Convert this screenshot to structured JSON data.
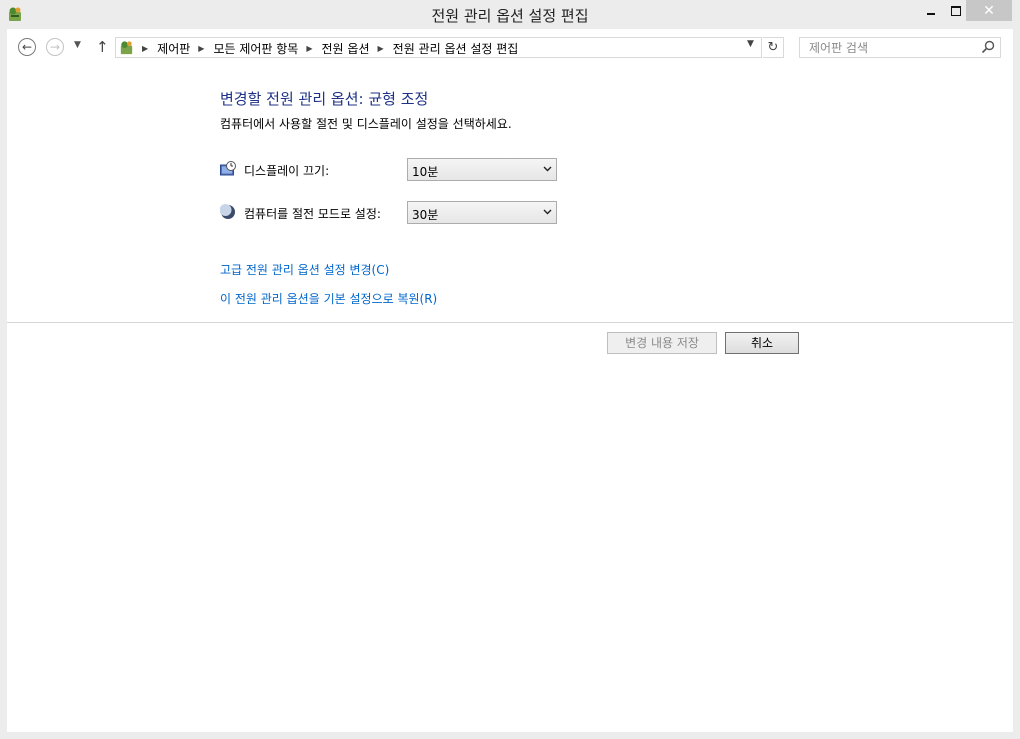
{
  "window": {
    "title": "전원 관리 옵션 설정 편집",
    "close_glyph": "✕"
  },
  "nav": {
    "back_glyph": "←",
    "forward_glyph": "→",
    "recent_glyph": "▼",
    "up_glyph": "↑",
    "breadcrumbs": [
      "제어판",
      "모든 제어판 항목",
      "전원 옵션",
      "전원 관리 옵션 설정 편집"
    ],
    "crumb_separator": "▶",
    "dropdown_glyph": "▼",
    "refresh_glyph": "↻"
  },
  "search": {
    "placeholder": "제어판 검색"
  },
  "main": {
    "heading": "변경할 전원 관리 옵션: 균형 조정",
    "description": "컴퓨터에서 사용할 절전 및 디스플레이 설정을 선택하세요.",
    "settings": {
      "display_off": {
        "label": "디스플레이 끄기:",
        "value": "10분",
        "icon": "display-clock-icon"
      },
      "sleep": {
        "label": "컴퓨터를 절전 모드로 설정:",
        "value": "30분",
        "icon": "moon-icon"
      }
    },
    "links": {
      "advanced": "고급 전원 관리 옵션 설정 변경(C)",
      "restore": "이 전원 관리 옵션을 기본 설정으로 복원(R)"
    }
  },
  "footer": {
    "save_label": "변경 내용 저장",
    "cancel_label": "취소"
  },
  "colors": {
    "heading": "#1e3287",
    "link": "#0066cc",
    "close_button": "#c7c7c7"
  }
}
